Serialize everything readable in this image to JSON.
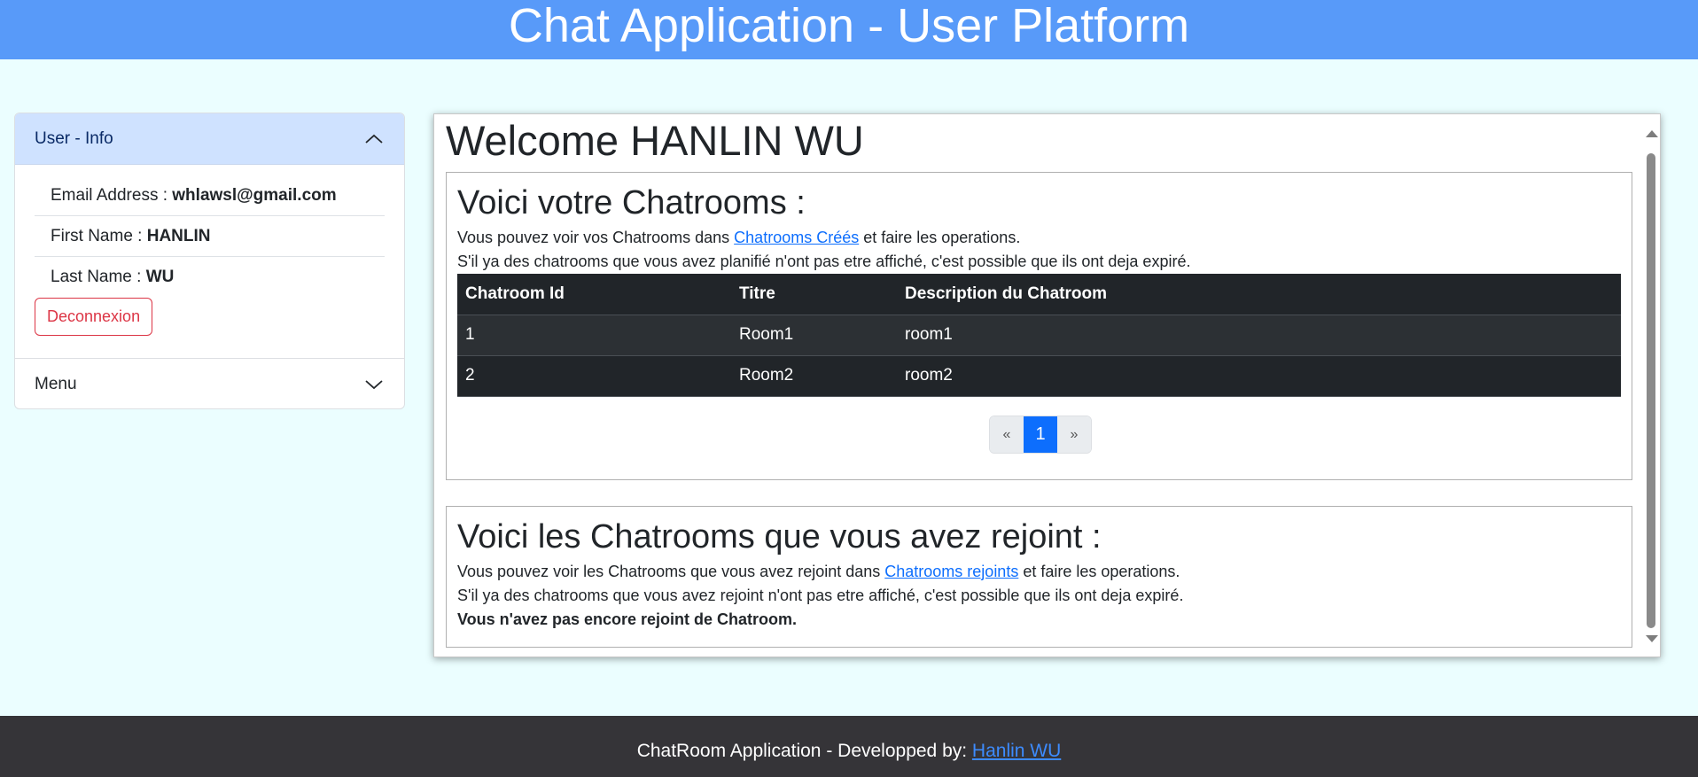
{
  "header": {
    "title": "Chat Application - User Platform"
  },
  "sidebar": {
    "user_section": {
      "label": "User - Info",
      "chevron": "chevron-up-icon"
    },
    "email": {
      "label": "Email Address : ",
      "value": "whlawsl@gmail.com"
    },
    "first_name": {
      "label": "First Name : ",
      "value": "HANLIN"
    },
    "last_name": {
      "label": "Last Name : ",
      "value": "WU"
    },
    "logout_label": "Deconnexion",
    "menu_section": {
      "label": "Menu",
      "chevron": "chevron-down-icon"
    }
  },
  "main": {
    "welcome": "Welcome HANLIN WU",
    "my_rooms": {
      "title": "Voici votre Chatrooms :",
      "line1_pre": "Vous pouvez voir vos Chatrooms dans ",
      "line1_link": "Chatrooms Créés",
      "line1_post": " et faire les operations.",
      "line2": "S'il ya des chatrooms que vous avez planifié n'ont pas etre affiché, c'est possible que ils ont deja expiré.",
      "columns": [
        "Chatroom Id",
        "Titre",
        "Description du Chatroom"
      ],
      "rows": [
        [
          "1",
          "Room1",
          "room1"
        ],
        [
          "2",
          "Room2",
          "room2"
        ]
      ],
      "pager": {
        "prev": "«",
        "current": "1",
        "next": "»"
      }
    },
    "joined_rooms": {
      "title": "Voici les Chatrooms que vous avez rejoint :",
      "line1_pre": "Vous pouvez voir les Chatrooms que vous avez rejoint dans ",
      "line1_link": "Chatrooms rejoints",
      "line1_post": " et faire les operations.",
      "line2": "S'il ya des chatrooms que vous avez rejoint n'ont pas etre affiché, c'est possible que ils ont deja expiré.",
      "empty_message": "Vous n'avez pas encore rejoint de Chatroom."
    }
  },
  "footer": {
    "text": "ChatRoom Application - Developped by: ",
    "link": "Hanlin WU"
  },
  "colors": {
    "header_bg": "#589af9",
    "page_bg": "#ebfeff",
    "footer_bg": "#353438",
    "accent": "#0d6efd",
    "danger": "#dc3545"
  }
}
